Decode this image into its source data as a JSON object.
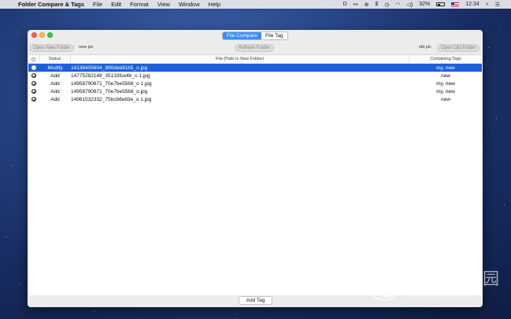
{
  "menubar": {
    "app_name": "Folder Compare & Tags",
    "menus": [
      "File",
      "Edit",
      "Format",
      "View",
      "Window",
      "Help"
    ],
    "battery": "32%",
    "clock": "12:34"
  },
  "window": {
    "tabs": [
      {
        "label": "File Compare",
        "active": true
      },
      {
        "label": "File Tag",
        "active": false
      }
    ],
    "open_new_folder": "Open New Folder",
    "new_folder_name": "new pic",
    "refresh_folder": "Refresh Folder",
    "old_folder_name": "old pic",
    "open_old_folder": "Open Old Folder",
    "columns": {
      "status": "Status",
      "file": "File (Path In New Folder)",
      "tags": "Containing Tags"
    },
    "rows": [
      {
        "status": "Modify",
        "file": "14136405604_990deb81b5_o.jpg",
        "tags": "my, new",
        "selected": true
      },
      {
        "status": "Add",
        "file": "14775282148_35133fce4b_o 1.jpg",
        "tags": "new",
        "selected": false
      },
      {
        "status": "Add",
        "file": "14958790671_70e7be5568_o 1.jpg",
        "tags": "my, new",
        "selected": false
      },
      {
        "status": "Add",
        "file": "14958790671_70e7be5568_o.jpg",
        "tags": "my, new",
        "selected": false
      },
      {
        "status": "Add",
        "file": "14961532332_75bcb8e83e_o 1.jpg",
        "tags": "new",
        "selected": false
      }
    ],
    "add_tag": "Add Tag"
  },
  "watermark": {
    "text_cn": "当下软件园",
    "url": "www.downxia.com"
  },
  "colors": {
    "accent": "#3b8ef0",
    "selection": "#1c5fd6"
  }
}
